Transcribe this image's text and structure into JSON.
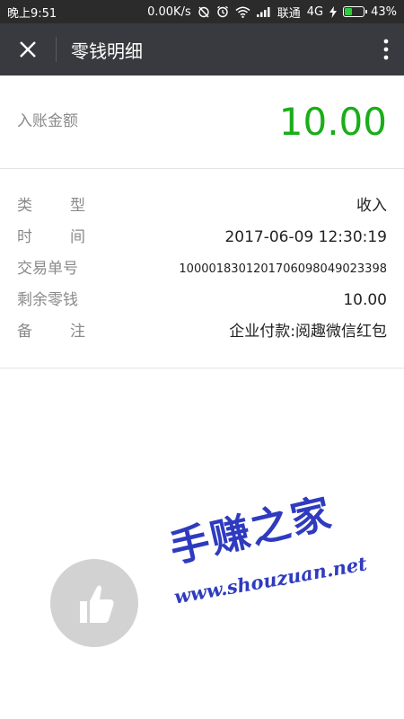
{
  "status_bar": {
    "time": "晚上9:51",
    "net_speed": "0.00K/s",
    "carrier": "联通",
    "network": "4G",
    "battery": "43%",
    "battery_level": 0.43,
    "battery_color": "#2ecc40"
  },
  "nav": {
    "title": "零钱明细",
    "close_icon": "close-icon",
    "more_icon": "more-vertical-icon",
    "background": "#393a3f"
  },
  "amount": {
    "label": "入账金额",
    "value": "10.00",
    "color": "#1aad19"
  },
  "details": {
    "type": {
      "label_chars": [
        "类",
        "型"
      ],
      "value": "收入"
    },
    "time": {
      "label_chars": [
        "时",
        "间"
      ],
      "value": "2017-06-09 12:30:19"
    },
    "order": {
      "label": "交易单号",
      "value": "1000018301201706098049023398"
    },
    "balance": {
      "label": "剩余零钱",
      "value": "10.00"
    },
    "note": {
      "label_chars": [
        "备",
        "注"
      ],
      "value": "企业付款:阅趣微信红包"
    }
  },
  "watermark": {
    "text_cn": "手赚之家",
    "text_en": "www.shouzuan.net",
    "icon": "thumbs-up-icon"
  }
}
